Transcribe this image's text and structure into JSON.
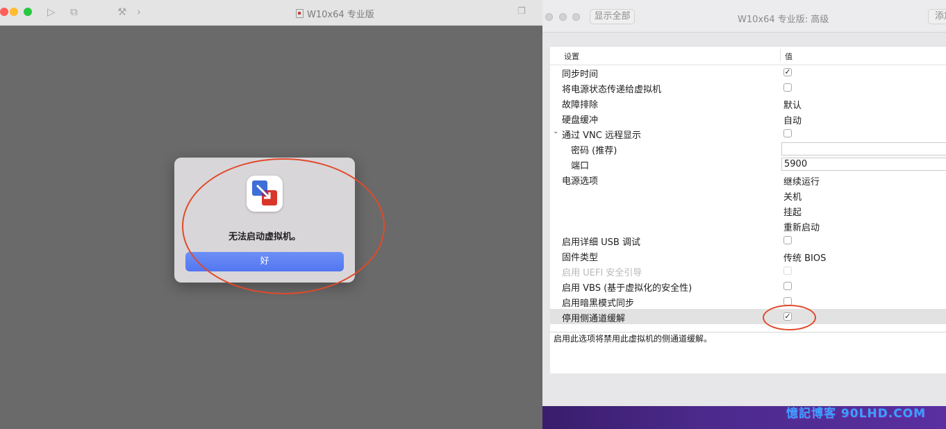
{
  "vm_window": {
    "title": "W10x64 专业版"
  },
  "alert": {
    "message": "无法启动虚拟机。",
    "ok_label": "好"
  },
  "settings_window": {
    "title": "W10x64 专业版: 高级",
    "show_all_label": "显示全部",
    "add_label": "添加",
    "table": {
      "column_setting": "设置",
      "column_value": "值",
      "rows": [
        {
          "label": "同步时间",
          "type": "checkbox",
          "checked": true,
          "check_glyph": "✓"
        },
        {
          "label": "将电源状态传递给虚拟机",
          "type": "checkbox",
          "checked": false
        },
        {
          "label": "故障排除",
          "type": "text",
          "value": "默认"
        },
        {
          "label": "硬盘缓冲",
          "type": "text",
          "value": "自动"
        },
        {
          "label": "通过 VNC 远程显示",
          "type": "checkbox",
          "checked": false,
          "expanded": true
        },
        {
          "label": "密码 (推荐)",
          "type": "textfield",
          "value": ""
        },
        {
          "label": "端口",
          "type": "textfield",
          "value": "5900"
        },
        {
          "label": "电源选项",
          "type": "text",
          "value": "继续运行"
        },
        {
          "label": "",
          "type": "text",
          "value": "关机"
        },
        {
          "label": "",
          "type": "text",
          "value": "挂起"
        },
        {
          "label": "",
          "type": "text",
          "value": "重新启动"
        },
        {
          "label": "启用详细 USB 调试",
          "type": "checkbox",
          "checked": false
        },
        {
          "label": "固件类型",
          "type": "text",
          "value": "传统 BIOS"
        },
        {
          "label": "启用 UEFI 安全引导",
          "type": "checkbox",
          "checked": false,
          "disabled": true
        },
        {
          "label": "启用 VBS (基于虚拟化的安全性)",
          "type": "checkbox",
          "checked": false
        },
        {
          "label": "启用暗黑模式同步",
          "type": "checkbox",
          "checked": false
        },
        {
          "label": "停用侧通道缓解",
          "type": "checkbox",
          "checked": true,
          "selected": true,
          "check_glyph": "✓"
        }
      ]
    },
    "description": "启用此选项将禁用此虚拟机的侧通道缓解。"
  },
  "watermark": "憶記博客 90LHD.COM",
  "colors": {
    "accent_blue": "#5a7ff3",
    "annotation_red": "#e04a2a",
    "traffic_red": "#fe5f57",
    "traffic_yellow": "#febc2e",
    "traffic_green": "#28c840"
  }
}
